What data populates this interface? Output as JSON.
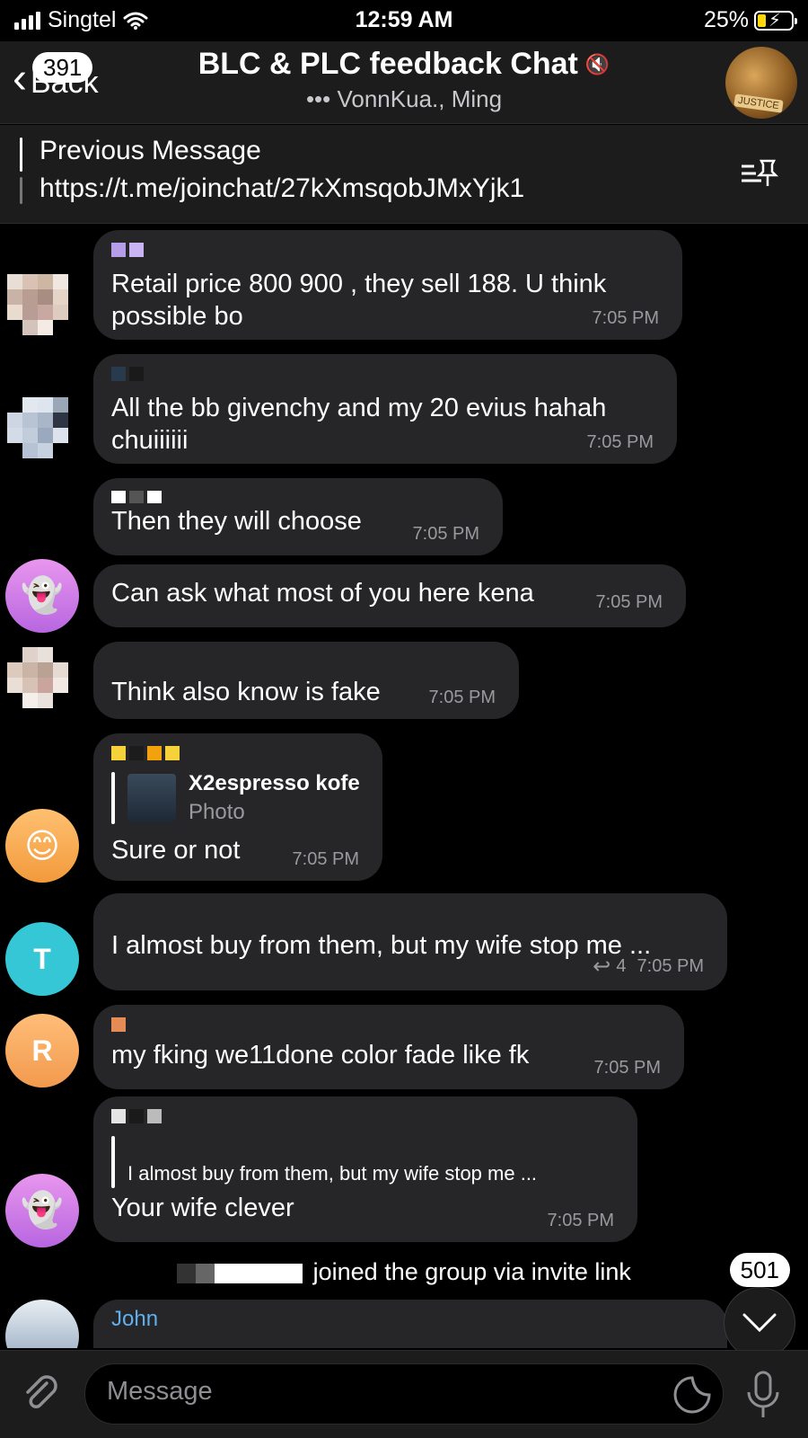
{
  "status": {
    "carrier": "Singtel",
    "time": "12:59 AM",
    "battery": "25%",
    "battery_level": 0.25,
    "battery_color": "#ffd60a"
  },
  "header": {
    "back_label": "Back",
    "back_badge": "391",
    "title": "BLC & PLC feedback Chat",
    "subtitle": "VonnKua., Ming",
    "avatar_text": "JUSTICE"
  },
  "pinned": {
    "title": "Previous Message",
    "text": "https://t.me/joinchat/27kXmsqobJMxYjk1"
  },
  "messages": [
    {
      "text": "Retail price 800 900 , they sell 188. U think possible bo",
      "time": "7:05 PM"
    },
    {
      "text": "All the bb givenchy and my 20 evius hahah chuiiiiii",
      "time": "7:05 PM"
    },
    {
      "text": "Then they will choose",
      "time": "7:05 PM"
    },
    {
      "text": "Can ask what most of you here kena",
      "time": "7:05 PM"
    },
    {
      "text": "Think also know is fake",
      "time": "7:05 PM"
    },
    {
      "text": "Sure or not",
      "time": "7:05 PM",
      "reply_name": "X2espresso kofe",
      "reply_text": "Photo"
    },
    {
      "text": "I almost buy from them, but my wife stop me ...",
      "time": "7:05 PM",
      "replies": "4",
      "avatar": "T"
    },
    {
      "text": "my fking we11done color fade like fk",
      "time": "7:05 PM",
      "avatar": "R"
    },
    {
      "text": "Your wife clever",
      "time": "7:05 PM",
      "reply_text": "I almost buy from them, but my wife stop me ..."
    }
  ],
  "system_message": "joined the group via invite link",
  "next_sender": "John",
  "scroll_badge": "501",
  "input": {
    "placeholder": "Message"
  },
  "colors": {
    "bubble": "#262628",
    "teal_avatar": "#35c7d6",
    "orange_avatar": "#f7a65a",
    "purple_avatar": "#c86fe0"
  }
}
